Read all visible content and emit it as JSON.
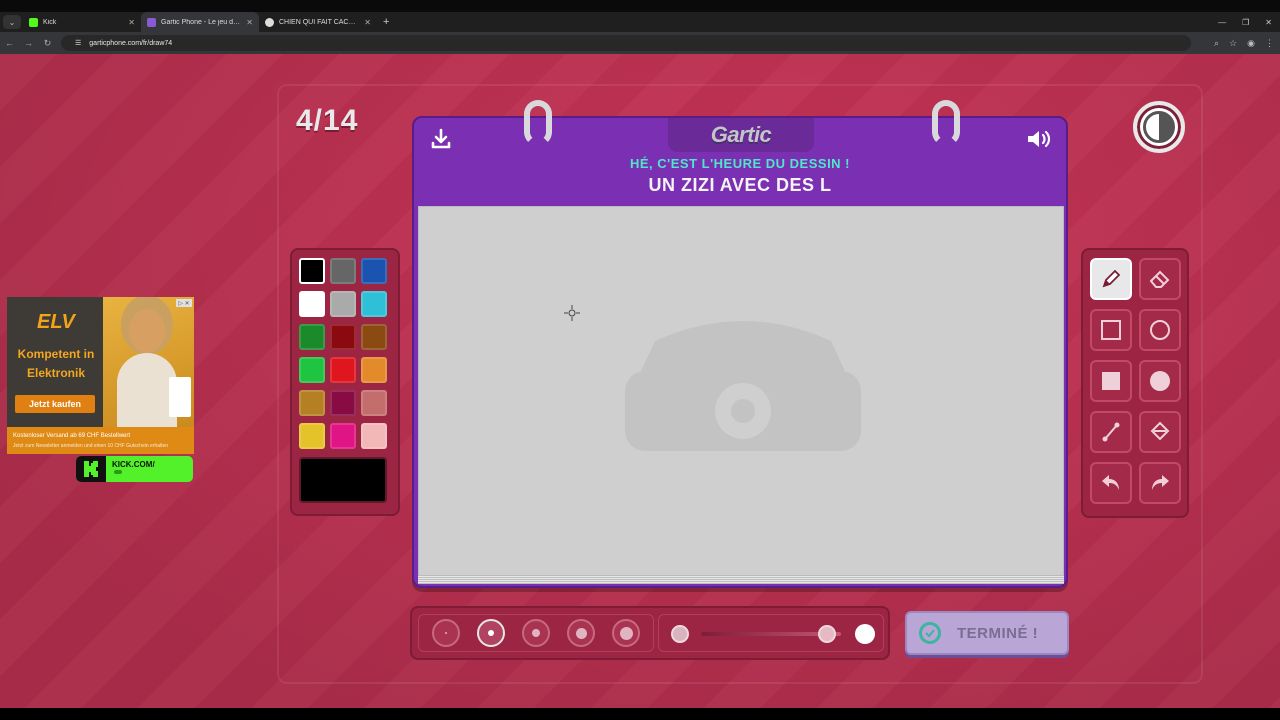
{
  "browser": {
    "tabs": [
      {
        "title": "Kick",
        "favicon_color": "#53fc18",
        "active": false
      },
      {
        "title": "Gartic Phone - Le jeu du téléph",
        "favicon_color": "#8a5ad6",
        "active": true
      },
      {
        "title": "CHIEN QUI FAIT CACA - Google",
        "favicon_color": "#dddddd",
        "active": false
      }
    ],
    "url": "garticphone.com/fr/draw74"
  },
  "game": {
    "round_counter": "4/14",
    "logo": "Gartic",
    "subtitle": "HÉ, C'EST L'HEURE DU DESSIN !",
    "prompt": "UN ZIZI AVEC DES L",
    "done_label": "TERMINÉ !",
    "colors": [
      "#000000",
      "#666666",
      "#1a54b0",
      "#ffffff",
      "#aaaaaa",
      "#2fc0d8",
      "#1b8a2a",
      "#8a0a10",
      "#8a4a12",
      "#1fc441",
      "#e0161e",
      "#e38a2a",
      "#b57f24",
      "#880b44",
      "#c46d6d",
      "#e4c22a",
      "#e01484",
      "#f2b8b8"
    ],
    "selected_color": "#000000",
    "brush_sizes": [
      1,
      2,
      3,
      4,
      5
    ],
    "selected_size_index": 1,
    "opacity_value": 0.9,
    "tools": [
      "pencil-icon",
      "eraser-icon",
      "rectangle-outline-icon",
      "circle-outline-icon",
      "rectangle-fill-icon",
      "circle-fill-icon",
      "line-icon",
      "fill-bucket-icon",
      "undo-icon",
      "redo-icon"
    ],
    "selected_tool": "pencil-icon"
  },
  "ad": {
    "logo": "ELV",
    "headline": "Kompetent in Elektronik",
    "cta": "Jetzt kaufen",
    "footer": "Kostenloser Versand ab 69 CHF Bestellwert",
    "footer_small": "Jetzt zum Newsletter anmelden und einen 10 CHF Gutschein erhalten"
  },
  "kick_widget": {
    "label": "KICK.COM/"
  }
}
